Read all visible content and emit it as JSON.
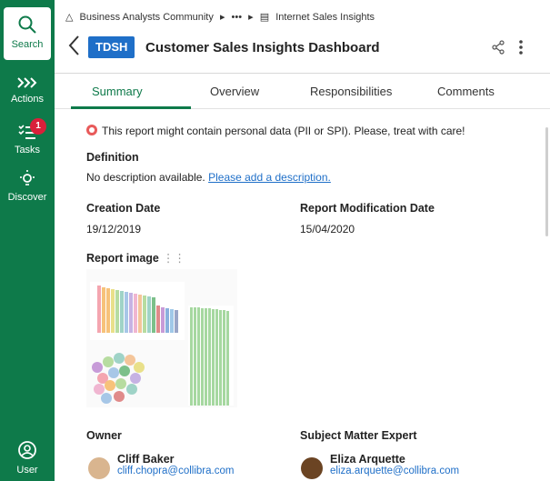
{
  "rail": {
    "search": "Search",
    "actions": "Actions",
    "tasks": "Tasks",
    "tasks_badge": "1",
    "discover": "Discover",
    "user": "User"
  },
  "breadcrumb": {
    "community": "Business Analysts Community",
    "ellipsis": "•••",
    "current": "Internet Sales Insights"
  },
  "header": {
    "tag": "TDSH",
    "title": "Customer Sales Insights Dashboard"
  },
  "tabs": [
    "Summary",
    "Overview",
    "Responsibilities",
    "Comments"
  ],
  "summary": {
    "warning": "This report might contain personal data (PII or SPI). Please, treat with care!",
    "definition_heading": "Definition",
    "definition_text": "No description available.",
    "definition_link": "Please add a description.",
    "creation_heading": "Creation Date",
    "creation_value": "19/12/2019",
    "modification_heading": "Report Modification Date",
    "modification_value": "15/04/2020",
    "report_image_heading": "Report image",
    "owner_heading": "Owner",
    "sme_heading": "Subject Matter Expert",
    "owner": {
      "name": "Cliff Baker",
      "email": "cliff.chopra@collibra.com"
    },
    "sme": {
      "name": "Eliza Arquette",
      "email": "eliza.arquette@collibra.com"
    }
  },
  "colors": {
    "brand": "#0e7a4a",
    "accent": "#1f6fc8",
    "badge": "#d9203a"
  }
}
